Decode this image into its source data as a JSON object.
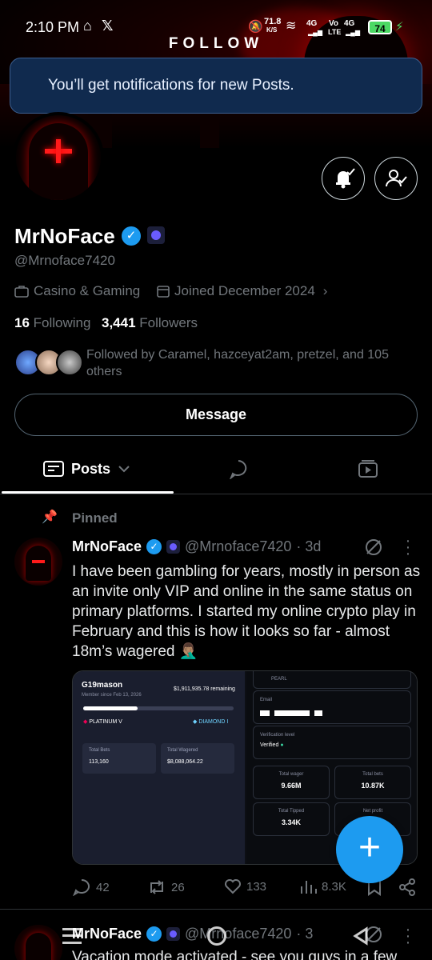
{
  "status": {
    "time": "2:10 PM",
    "speed": "71.8",
    "speed_unit": "K/S",
    "net1": "4G",
    "volte": "Vo",
    "lte": "LTE",
    "net2": "4G",
    "battery": "74"
  },
  "banner": {
    "follow_word": "FOLLOW"
  },
  "toast": {
    "text": "You’ll get notifications for new Posts."
  },
  "profile": {
    "name": "MrNoFace",
    "handle": "@Mrnoface7420",
    "category": "Casino & Gaming",
    "joined": "Joined December 2024",
    "following_count": "16",
    "following_label": "Following",
    "followers_count": "3,441",
    "followers_label": "Followers",
    "followed_by": "Followed by Caramel, hazceyat2am, pretzel, and 105 others"
  },
  "buttons": {
    "message": "Message"
  },
  "tabs": {
    "posts": "Posts"
  },
  "post": {
    "pinned": "Pinned",
    "name": "MrNoFace",
    "handle": "@Mrnoface7420",
    "time": "· 3d",
    "text": "I have been gambling for years, mostly in person as an invite only VIP and online in the same status on primary platforms. I started my online crypto play in February and this is how it looks so far - almost 18m’s wagered 🤦🏽‍♂️",
    "replies": "42",
    "reposts": "26",
    "likes": "133",
    "views": "8.3K",
    "media": {
      "user": "G19mason",
      "member_since": "Member since Feb 13, 2026",
      "remaining": "$1,911,935.78 remaining",
      "rank_left": "PLATINUM V",
      "rank_right": "DIAMOND I",
      "total_bets_label": "Total Bets",
      "total_bets": "113,160",
      "total_wagered_label": "Total Wagered",
      "total_wagered": "$8,088,064.22",
      "pearl": "PEARL",
      "email_label": "Email",
      "verification_label": "Verification level",
      "verified": "Verified",
      "total_wager_label": "Total wager",
      "total_wager": "9.66M",
      "total_bets2_label": "Total bets",
      "total_bets2": "10.87K",
      "total_tipped_label": "Total Tipped",
      "total_tipped": "3.34K",
      "net_profit_label": "Net profit"
    }
  },
  "post2": {
    "name": "MrNoFace",
    "handle": "@Mrnoface7420",
    "time": "· 3",
    "text": "Vacation mode activated - see you guys in a few"
  },
  "colors": {
    "accent": "#1d9bf0",
    "toast_bg": "#102a4e"
  }
}
